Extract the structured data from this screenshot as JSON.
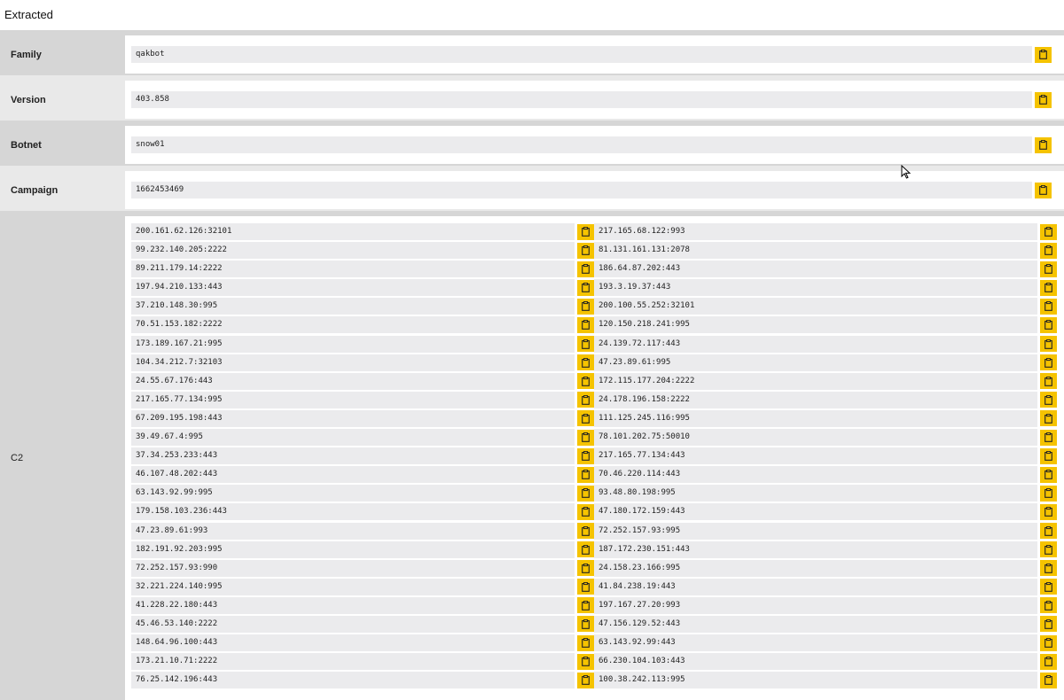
{
  "header": {
    "title": "Extracted"
  },
  "rows": [
    {
      "label": "Family",
      "value": "qakbot"
    },
    {
      "label": "Version",
      "value": "403.858"
    },
    {
      "label": "Botnet",
      "value": "snow01"
    },
    {
      "label": "Campaign",
      "value": "1662453469"
    }
  ],
  "c2": {
    "label": "C2",
    "left": [
      "200.161.62.126:32101",
      "99.232.140.205:2222",
      "89.211.179.14:2222",
      "197.94.210.133:443",
      "37.210.148.30:995",
      "70.51.153.182:2222",
      "173.189.167.21:995",
      "104.34.212.7:32103",
      "24.55.67.176:443",
      "217.165.77.134:995",
      "67.209.195.198:443",
      "39.49.67.4:995",
      "37.34.253.233:443",
      "46.107.48.202:443",
      "63.143.92.99:995",
      "179.158.103.236:443",
      "47.23.89.61:993",
      "182.191.92.203:995",
      "72.252.157.93:990",
      "32.221.224.140:995",
      "41.228.22.180:443",
      "45.46.53.140:2222",
      "148.64.96.100:443",
      "173.21.10.71:2222",
      "76.25.142.196:443"
    ],
    "right": [
      "217.165.68.122:993",
      "81.131.161.131:2078",
      "186.64.87.202:443",
      "193.3.19.37:443",
      "200.100.55.252:32101",
      "120.150.218.241:995",
      "24.139.72.117:443",
      "47.23.89.61:995",
      "172.115.177.204:2222",
      "24.178.196.158:2222",
      "111.125.245.116:995",
      "78.101.202.75:50010",
      "217.165.77.134:443",
      "70.46.220.114:443",
      "93.48.80.198:995",
      "47.180.172.159:443",
      "72.252.157.93:995",
      "187.172.230.151:443",
      "24.158.23.166:995",
      "41.84.238.19:443",
      "197.167.27.20:993",
      "47.156.129.52:443",
      "63.143.92.99:443",
      "66.230.104.103:443",
      "100.38.242.113:995"
    ]
  },
  "icons": {
    "copy": "clipboard-icon",
    "cursor": "mouse-pointer-icon"
  },
  "colors": {
    "copy_button": "#f5c300",
    "field_bg": "#ebebed",
    "label_bg": "#d6d6d6"
  }
}
